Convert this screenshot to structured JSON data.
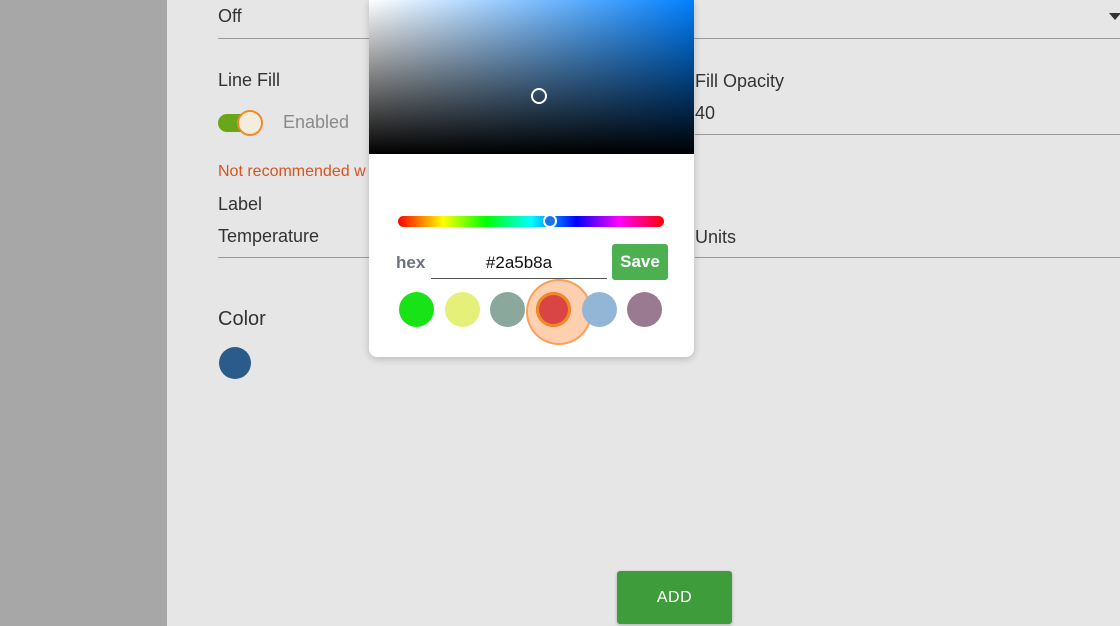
{
  "form": {
    "top_dropdown_value": "Off",
    "line_fill_label": "Line Fill",
    "line_fill_toggle_text": "Enabled",
    "fill_opacity_label": "Fill Opacity",
    "fill_opacity_value": "40",
    "warning_text": "Not recommended w",
    "label_label": "Label",
    "label_value": "Temperature",
    "units_label": "Units",
    "color_label": "Color",
    "color_value": "#2a5b8a",
    "add_label": "ADD"
  },
  "picker": {
    "hex_label": "hex",
    "hex_value": "#2a5b8a",
    "save_label": "Save",
    "swatches": [
      "#17e317",
      "#e5f07a",
      "#8aa89c",
      "#d94545",
      "#94b6d6",
      "#9a7a90"
    ],
    "selected_swatch": 3
  }
}
